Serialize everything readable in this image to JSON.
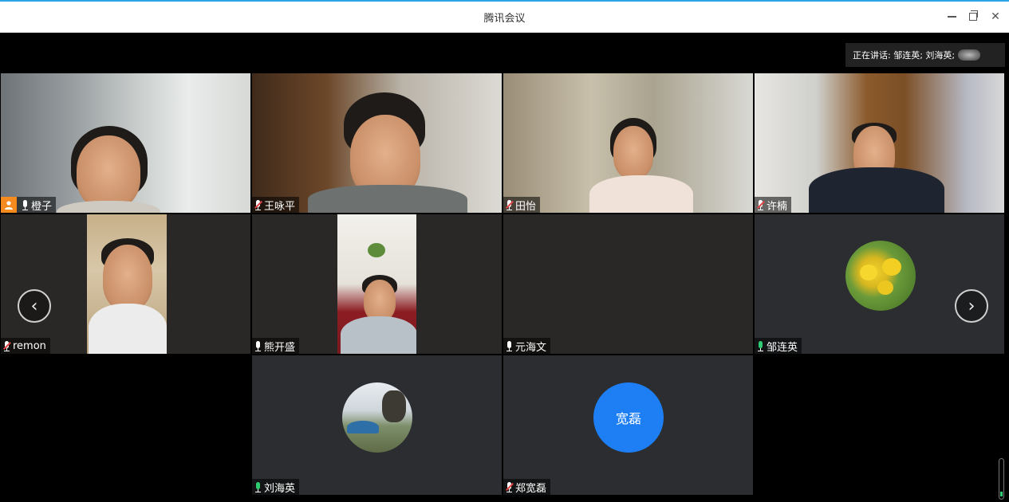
{
  "window": {
    "title": "腾讯会议"
  },
  "speaking": {
    "label": "正在讲话: 邹连英; 刘海英;"
  },
  "participants": [
    {
      "name": "橙子",
      "host": true,
      "mic": "on"
    },
    {
      "name": "王咏平",
      "mic": "muted"
    },
    {
      "name": "田怡",
      "mic": "muted"
    },
    {
      "name": "许楠",
      "mic": "muted"
    },
    {
      "name": "remon",
      "mic": "muted"
    },
    {
      "name": "熊开盛",
      "mic": "on"
    },
    {
      "name": "元海文",
      "mic": "on"
    },
    {
      "name": "邹连英",
      "mic": "speaking"
    },
    {
      "name": "刘海英",
      "mic": "speaking"
    },
    {
      "name": "郑宽磊",
      "mic": "muted",
      "avatar_text": "宽磊",
      "avatar_color": "#1e7ff5"
    }
  ],
  "colors": {
    "title_accent": "#2aa6e8",
    "host_badge": "#f58a1f",
    "muted": "#e24545",
    "speaking": "#2ecc71"
  },
  "icons": {
    "prev": "chevron-left-icon",
    "next": "chevron-right-icon"
  }
}
